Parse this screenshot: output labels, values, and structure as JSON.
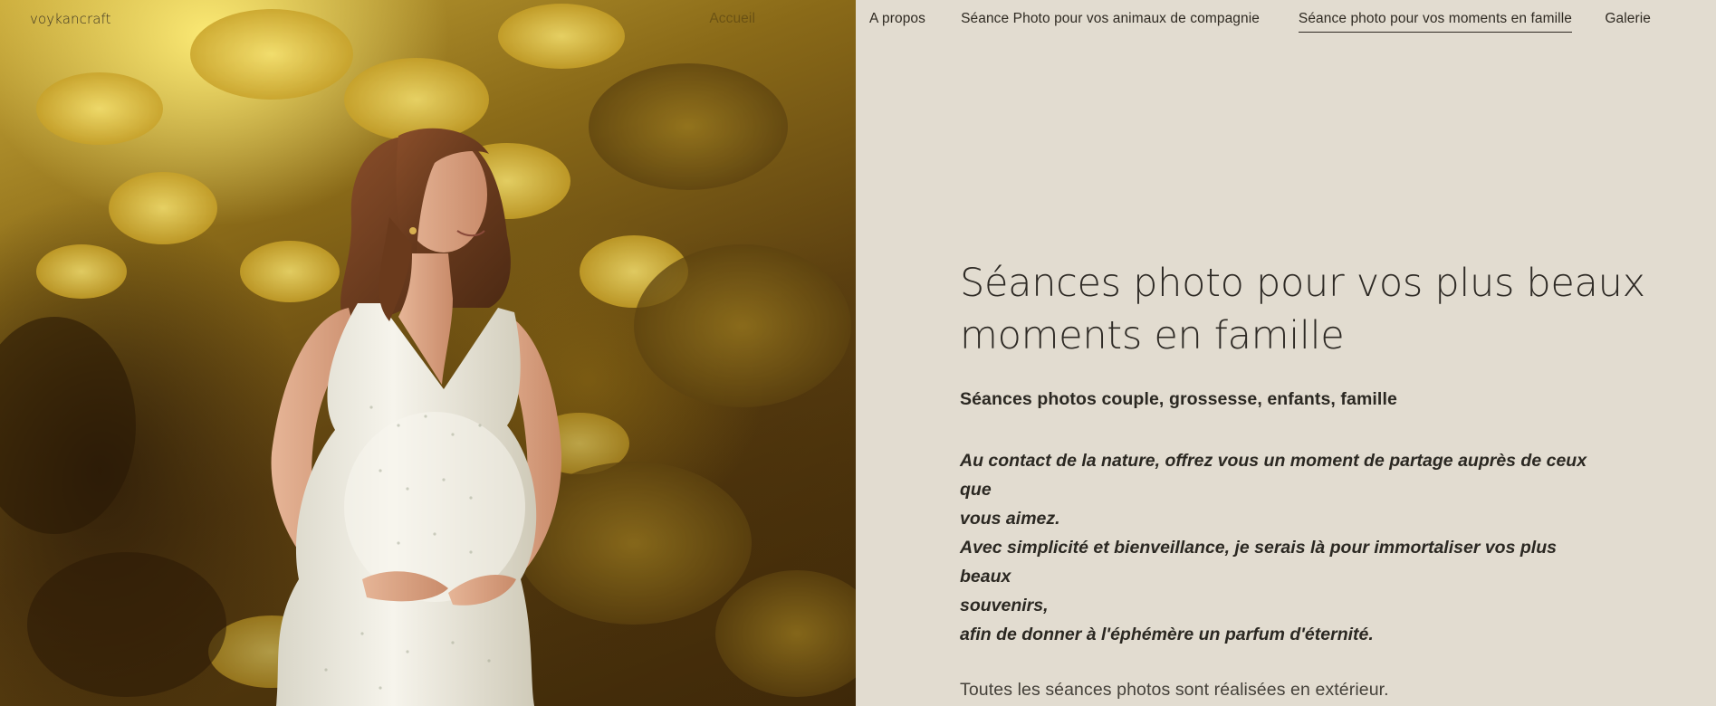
{
  "header": {
    "brand": "voykancraft",
    "nav": [
      {
        "label": "Accueil",
        "state": "faded"
      },
      {
        "label": "A propos",
        "state": "normal"
      },
      {
        "label": "Séance Photo pour vos animaux de compagnie",
        "state": "normal"
      },
      {
        "label": "Séance photo pour vos moments en famille",
        "state": "active"
      },
      {
        "label": "Galerie",
        "state": "normal"
      }
    ]
  },
  "hero": {
    "title_line1": "Séances photo pour vos plus beaux",
    "title_line2": "moments en famille",
    "subtitle": "Séances photos couple, grossesse, enfants, famille",
    "quote_lines": [
      "Au contact de la nature, offrez vous un moment de partage auprès de ceux que",
      "vous aimez.",
      "Avec simplicité et bienveillance, je serais là pour immortaliser vos plus beaux",
      "souvenirs,",
      "afin de donner à l'éphémère un parfum d'éternité."
    ],
    "note": "Toutes les séances photos sont réalisées en extérieur."
  },
  "colors": {
    "page_background": "#e2dcd0",
    "text": "#2e2a25",
    "foliage_light": "#e8d24a",
    "foliage_dark": "#3a2608",
    "dress": "#f2f0e6"
  }
}
